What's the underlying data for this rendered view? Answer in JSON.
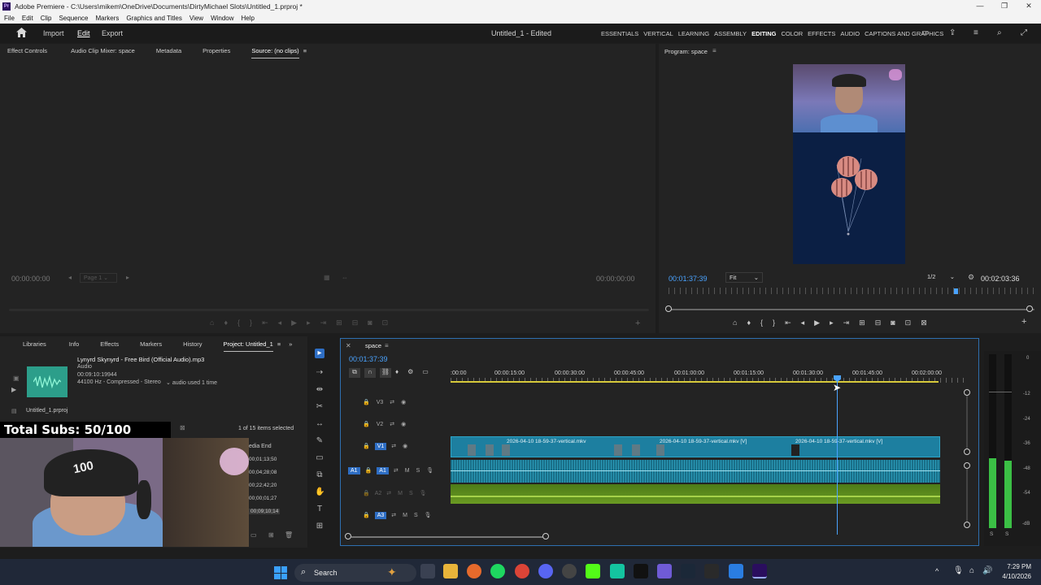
{
  "app": {
    "title": "Adobe Premiere - C:\\Users\\mikem\\OneDrive\\Documents\\DirtyMichael Slots\\Untitled_1.prproj *",
    "icon_label": "Pr"
  },
  "menu": [
    "File",
    "Edit",
    "Clip",
    "Sequence",
    "Markers",
    "Graphics and Titles",
    "View",
    "Window",
    "Help"
  ],
  "nav": {
    "import": "Import",
    "edit": "Edit",
    "export": "Export",
    "doc_title": "Untitled_1 - Edited"
  },
  "workspaces": [
    "ESSENTIALS",
    "VERTICAL",
    "LEARNING",
    "ASSEMBLY",
    "EDITING",
    "COLOR",
    "EFFECTS",
    "AUDIO",
    "CAPTIONS AND GRAPHICS"
  ],
  "active_workspace": "EDITING",
  "source_panel": {
    "tabs": [
      "Effect Controls",
      "Audio Clip Mixer: space",
      "Metadata",
      "Properties",
      "Source: (no clips)"
    ],
    "timecode_left": "00:00:00:00",
    "page_select": "Page 1",
    "timecode_right": "00:00:00:00"
  },
  "program_panel": {
    "tab": "Program: space",
    "timecode": "00:01:37:39",
    "fit": "Fit",
    "resolution": "1/2",
    "duration": "00:02:03:36",
    "playhead_fraction": 0.78
  },
  "project_panel": {
    "tabs": [
      "Libraries",
      "Info",
      "Effects",
      "Markers",
      "History",
      "Project: Untitled_1"
    ],
    "clip_name": "Lynyrd Skynyrd - Free Bird (Official Audio).mp3",
    "clip_type": "Audio",
    "clip_duration": "00:09:10:19944",
    "clip_format": "44100 Hz - Compressed - Stereo",
    "clip_usage": "audio used 1 time",
    "project_file": "Untitled_1.prproj",
    "selection": "1 of 15 items selected",
    "col_header": "edia End",
    "rows": [
      "00;01;13;50",
      "00;04;28;08",
      "00;22;42;20",
      "00;00;01;27",
      "00;09;10;14"
    ]
  },
  "overlay": {
    "subs_text": "Total Subs: 50/100",
    "cap_text": "100"
  },
  "timeline": {
    "sequence_name": "space",
    "timecode": "00:01:37:39",
    "ruler": [
      ":00:00",
      "00:00:15:00",
      "00:00:30:00",
      "00:00:45:00",
      "00:01:00:00",
      "00:01:15:00",
      "00:01:30:00",
      "00:01:45:00",
      "00:02:00:00"
    ],
    "tracks": {
      "v3": "V3",
      "v2": "V2",
      "v1": "V1",
      "a1": "A1",
      "a2": "A2",
      "a3": "A3",
      "m": "M",
      "s": "S"
    },
    "clip_names": [
      "2026-04-10 18-59-37-vertical.mkv",
      "2026-04-10 18-59-37-vertical.mkv [V]",
      "2026-04-10 18-59-37-vertical.mkv [V]"
    ]
  },
  "meter": {
    "labels": [
      "0",
      "-12",
      "-24",
      "-36",
      "-48",
      "-54",
      "-dB"
    ],
    "bottom": [
      "S",
      "S"
    ]
  },
  "taskbar": {
    "search": "Search",
    "time": "7:29 PM",
    "date": "4/10/2026"
  },
  "colors": {
    "accent": "#4aa3ff",
    "video_clip": "#1d7fa0",
    "audio_clip": "#1a6f88",
    "music_clip": "#5a8a1c",
    "playhead": "#4aa3ff"
  }
}
